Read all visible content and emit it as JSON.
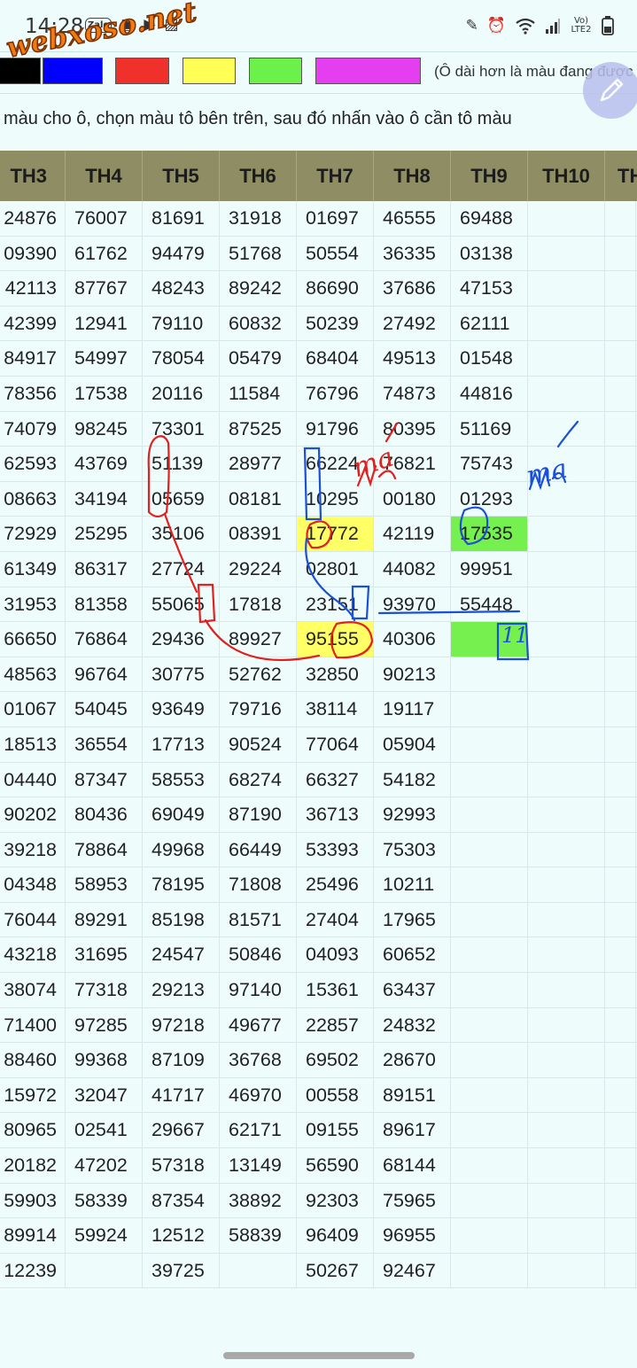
{
  "status_bar": {
    "time": "14:28",
    "left_icons": [
      "zalo-icon",
      "sim-card-icon",
      "video-icon",
      "gallery-icon"
    ],
    "right_icons": [
      "edit-icon",
      "alarm-icon",
      "wifi-icon",
      "signal-icon",
      "volte-icon",
      "battery-icon"
    ],
    "zalo_label": "Zalo",
    "volte_label": "Vo) LTE2"
  },
  "watermark": "webxoso.net",
  "palette": {
    "colors": [
      "#000000",
      "#0000ff",
      "#f0302a",
      "#ffff55",
      "#6cf04a",
      "#e53df0"
    ],
    "note": "(Ô dài hơn là màu đang được c"
  },
  "instruction": "màu cho ô, chọn màu tô bên trên, sau đó nhấn vào ô cần tô màu",
  "table": {
    "headers": [
      "TH3",
      "TH4",
      "TH5",
      "TH6",
      "TH7",
      "TH8",
      "TH9",
      "TH10",
      "TH"
    ],
    "rows": [
      [
        "24876",
        "76007",
        "81691",
        "31918",
        "01697",
        "46555",
        "69488"
      ],
      [
        "09390",
        "61762",
        "94479",
        "51768",
        "50554",
        "36335",
        "03138"
      ],
      [
        "42113",
        "87767",
        "48243",
        "89242",
        "86690",
        "37686",
        "47153"
      ],
      [
        "42399",
        "12941",
        "79110",
        "60832",
        "50239",
        "27492",
        "62111"
      ],
      [
        "84917",
        "54997",
        "78054",
        "05479",
        "68404",
        "49513",
        "01548"
      ],
      [
        "78356",
        "17538",
        "20116",
        "11584",
        "76796",
        "74873",
        "44816"
      ],
      [
        "74079",
        "98245",
        "73301",
        "87525",
        "91796",
        "80395",
        "51169"
      ],
      [
        "62593",
        "43769",
        "51139",
        "28977",
        "66224",
        "76821",
        "75743"
      ],
      [
        "08663",
        "34194",
        "05659",
        "08181",
        "10295",
        "00180",
        "01293"
      ],
      [
        "72929",
        "25295",
        "35106",
        "08391",
        "17772",
        "42119",
        "17535"
      ],
      [
        "61349",
        "86317",
        "27724",
        "29224",
        "02801",
        "44082",
        "99951"
      ],
      [
        "31953",
        "81358",
        "55065",
        "17818",
        "23151",
        "93970",
        "55448"
      ],
      [
        "66650",
        "76864",
        "29436",
        "89927",
        "95155",
        "40306",
        ""
      ],
      [
        "48563",
        "96764",
        "30775",
        "52762",
        "32850",
        "90213",
        ""
      ],
      [
        "01067",
        "54045",
        "93649",
        "79716",
        "38114",
        "19117",
        ""
      ],
      [
        "18513",
        "36554",
        "17713",
        "90524",
        "77064",
        "05904",
        ""
      ],
      [
        "04440",
        "87347",
        "58553",
        "68274",
        "66327",
        "54182",
        ""
      ],
      [
        "90202",
        "80436",
        "69049",
        "87190",
        "36713",
        "92993",
        ""
      ],
      [
        "39218",
        "78864",
        "49968",
        "66449",
        "53393",
        "75303",
        ""
      ],
      [
        "04348",
        "58953",
        "78195",
        "71808",
        "25496",
        "10211",
        ""
      ],
      [
        "76044",
        "89291",
        "85198",
        "81571",
        "27404",
        "17965",
        ""
      ],
      [
        "43218",
        "31695",
        "24547",
        "50846",
        "04093",
        "60652",
        ""
      ],
      [
        "38074",
        "77318",
        "29213",
        "97140",
        "15361",
        "63437",
        ""
      ],
      [
        "71400",
        "97285",
        "97218",
        "49677",
        "22857",
        "24832",
        ""
      ],
      [
        "88460",
        "99368",
        "87109",
        "36768",
        "69502",
        "28670",
        ""
      ],
      [
        "15972",
        "32047",
        "41717",
        "46970",
        "00558",
        "89151",
        ""
      ],
      [
        "80965",
        "02541",
        "29667",
        "62171",
        "09155",
        "89617",
        ""
      ],
      [
        "20182",
        "47202",
        "57318",
        "13149",
        "56590",
        "68144",
        ""
      ],
      [
        "59903",
        "58339",
        "87354",
        "38892",
        "92303",
        "75965",
        ""
      ],
      [
        "89914",
        "59924",
        "12512",
        "58839",
        "96409",
        "96955",
        ""
      ],
      [
        "12239",
        "",
        "39725",
        "",
        "50267",
        "92467",
        ""
      ]
    ],
    "highlights": [
      {
        "row": 9,
        "col": 4,
        "color": "#ffff66"
      },
      {
        "row": 9,
        "col": 6,
        "color": "#76f04f"
      },
      {
        "row": 12,
        "col": 4,
        "color": "#ffff66"
      },
      {
        "row": 12,
        "col": 6,
        "color": "#76f04f"
      }
    ]
  },
  "annotations": {
    "red_label": "ma",
    "blue_label": "ma",
    "blue_number": "11"
  }
}
